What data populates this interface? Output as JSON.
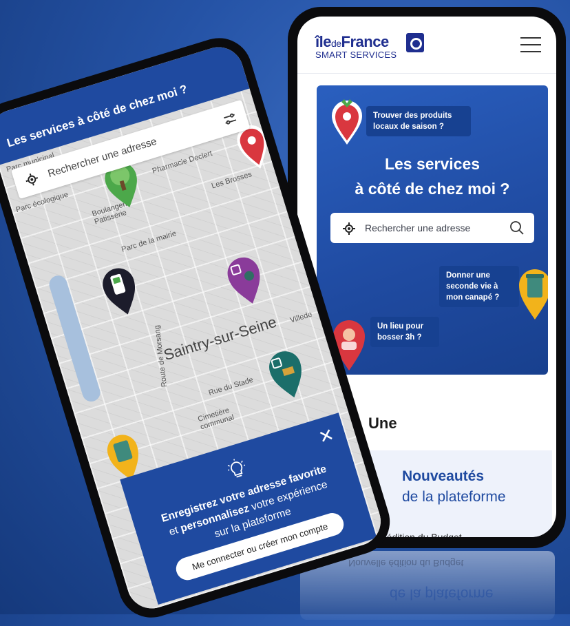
{
  "right_phone": {
    "brand": {
      "line1_pre": "île",
      "line1_de": "de",
      "line1_post": "France",
      "line2": "SMART SERVICES"
    },
    "hero": {
      "bubble_top": "Trouver des produits locaux de saison ?",
      "title_line1": "Les services",
      "title_line2": "à côté de chez moi ?",
      "search_placeholder": "Rechercher une adresse",
      "bubble_right": "Donner une seconde vie à mon canapé ?",
      "bubble_left": "Un lieu pour bosser 3h ?"
    },
    "section_title": "Une",
    "news": {
      "title_bold": "Nouveautés",
      "title_rest": "de la plateforme",
      "item": "elle édition du Budget"
    }
  },
  "left_phone": {
    "header_title": "Les services à côté de chez moi ?",
    "search_placeholder": "Rechercher une adresse",
    "map_labels": {
      "parc_municipal": "Parc municipal",
      "parc_ecologique": "Parc écologique",
      "pharmacie": "Pharmacie Declert",
      "boulangerie": "Boulangerie Patisserie",
      "les_brosses": "Les Brosses",
      "parc_mairie": "Parc de la mairie",
      "route": "Route de Morsang",
      "town": "Saintry-sur-Seine",
      "rue_stade": "Rue du Stade",
      "cimetiere": "Cimetière communal",
      "villede": "Villede"
    },
    "popup": {
      "line1_bold": "Enregistrez votre adresse favorite",
      "line2_pre": "et ",
      "line2_bold": "personnalisez",
      "line2_post": " votre expérience",
      "line3": "sur la plateforme",
      "button": "Me connecter ou créer mon compte"
    }
  },
  "reflection": {
    "text1": "Nouvelle édition du Budget",
    "text2": "de la plateforme"
  },
  "colors": {
    "brand_blue": "#1f4aa0",
    "navy": "#1f2e8f",
    "pin_red": "#d9373f",
    "pin_yellow": "#f2b31b",
    "pin_purple": "#8a3b9a",
    "pin_teal": "#1b6e6a"
  }
}
